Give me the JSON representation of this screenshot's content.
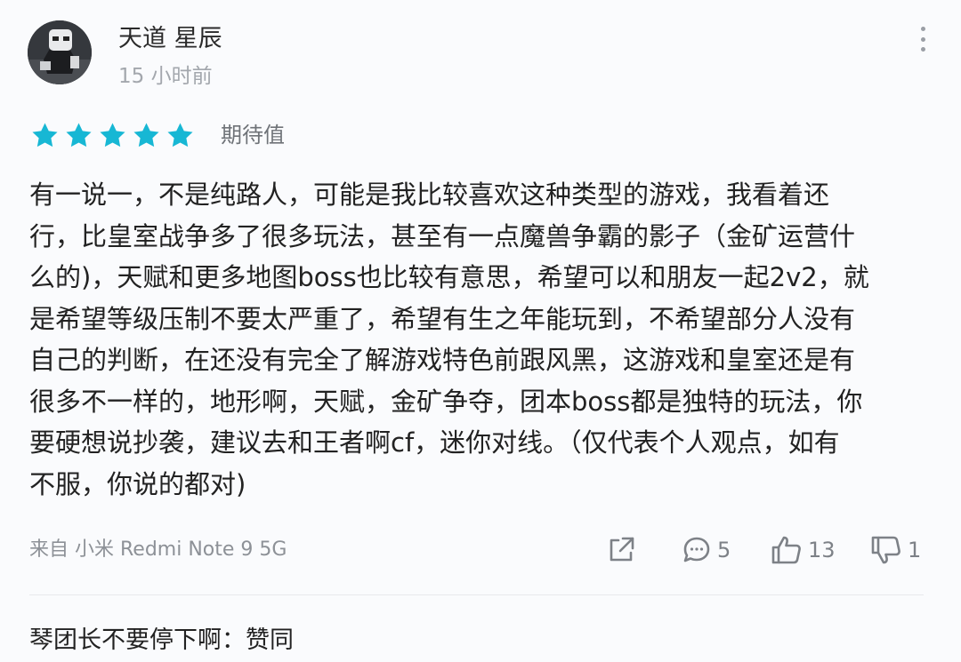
{
  "user": {
    "name": "天道 星辰",
    "time": "15 小时前"
  },
  "rating": {
    "stars": 5,
    "max_stars": 5,
    "label": "期待值",
    "star_color": "#17b7d4"
  },
  "review": {
    "lines": [
      "有一说一，不是纯路人，可能是我比较喜欢这种类型的游戏，我看着还",
      "行，比皇室战争多了很多玩法，甚至有一点魔兽争霸的影子（金矿运营什",
      "么的)，天赋和更多地图boss也比较有意思，希望可以和朋友一起2v2，就",
      "是希望等级压制不要太严重了，希望有生之年能玩到，不希望部分人没有",
      "自己的判断，在还没有完全了解游戏特色前跟风黑，这游戏和皇室还是有",
      "很多不一样的，地形啊，天赋，金矿争夺，团本boss都是独特的玩法，你",
      "要硬想说抄袭，建议去和王者啊cf，迷你对线。（仅代表个人观点，如有",
      "不服，你说的都对)"
    ]
  },
  "footer": {
    "device": "来自 小米 Redmi Note 9 5G",
    "comments": "5",
    "likes": "13",
    "dislikes": "1"
  },
  "reply": {
    "text": "琴团长不要停下啊：赞同"
  }
}
